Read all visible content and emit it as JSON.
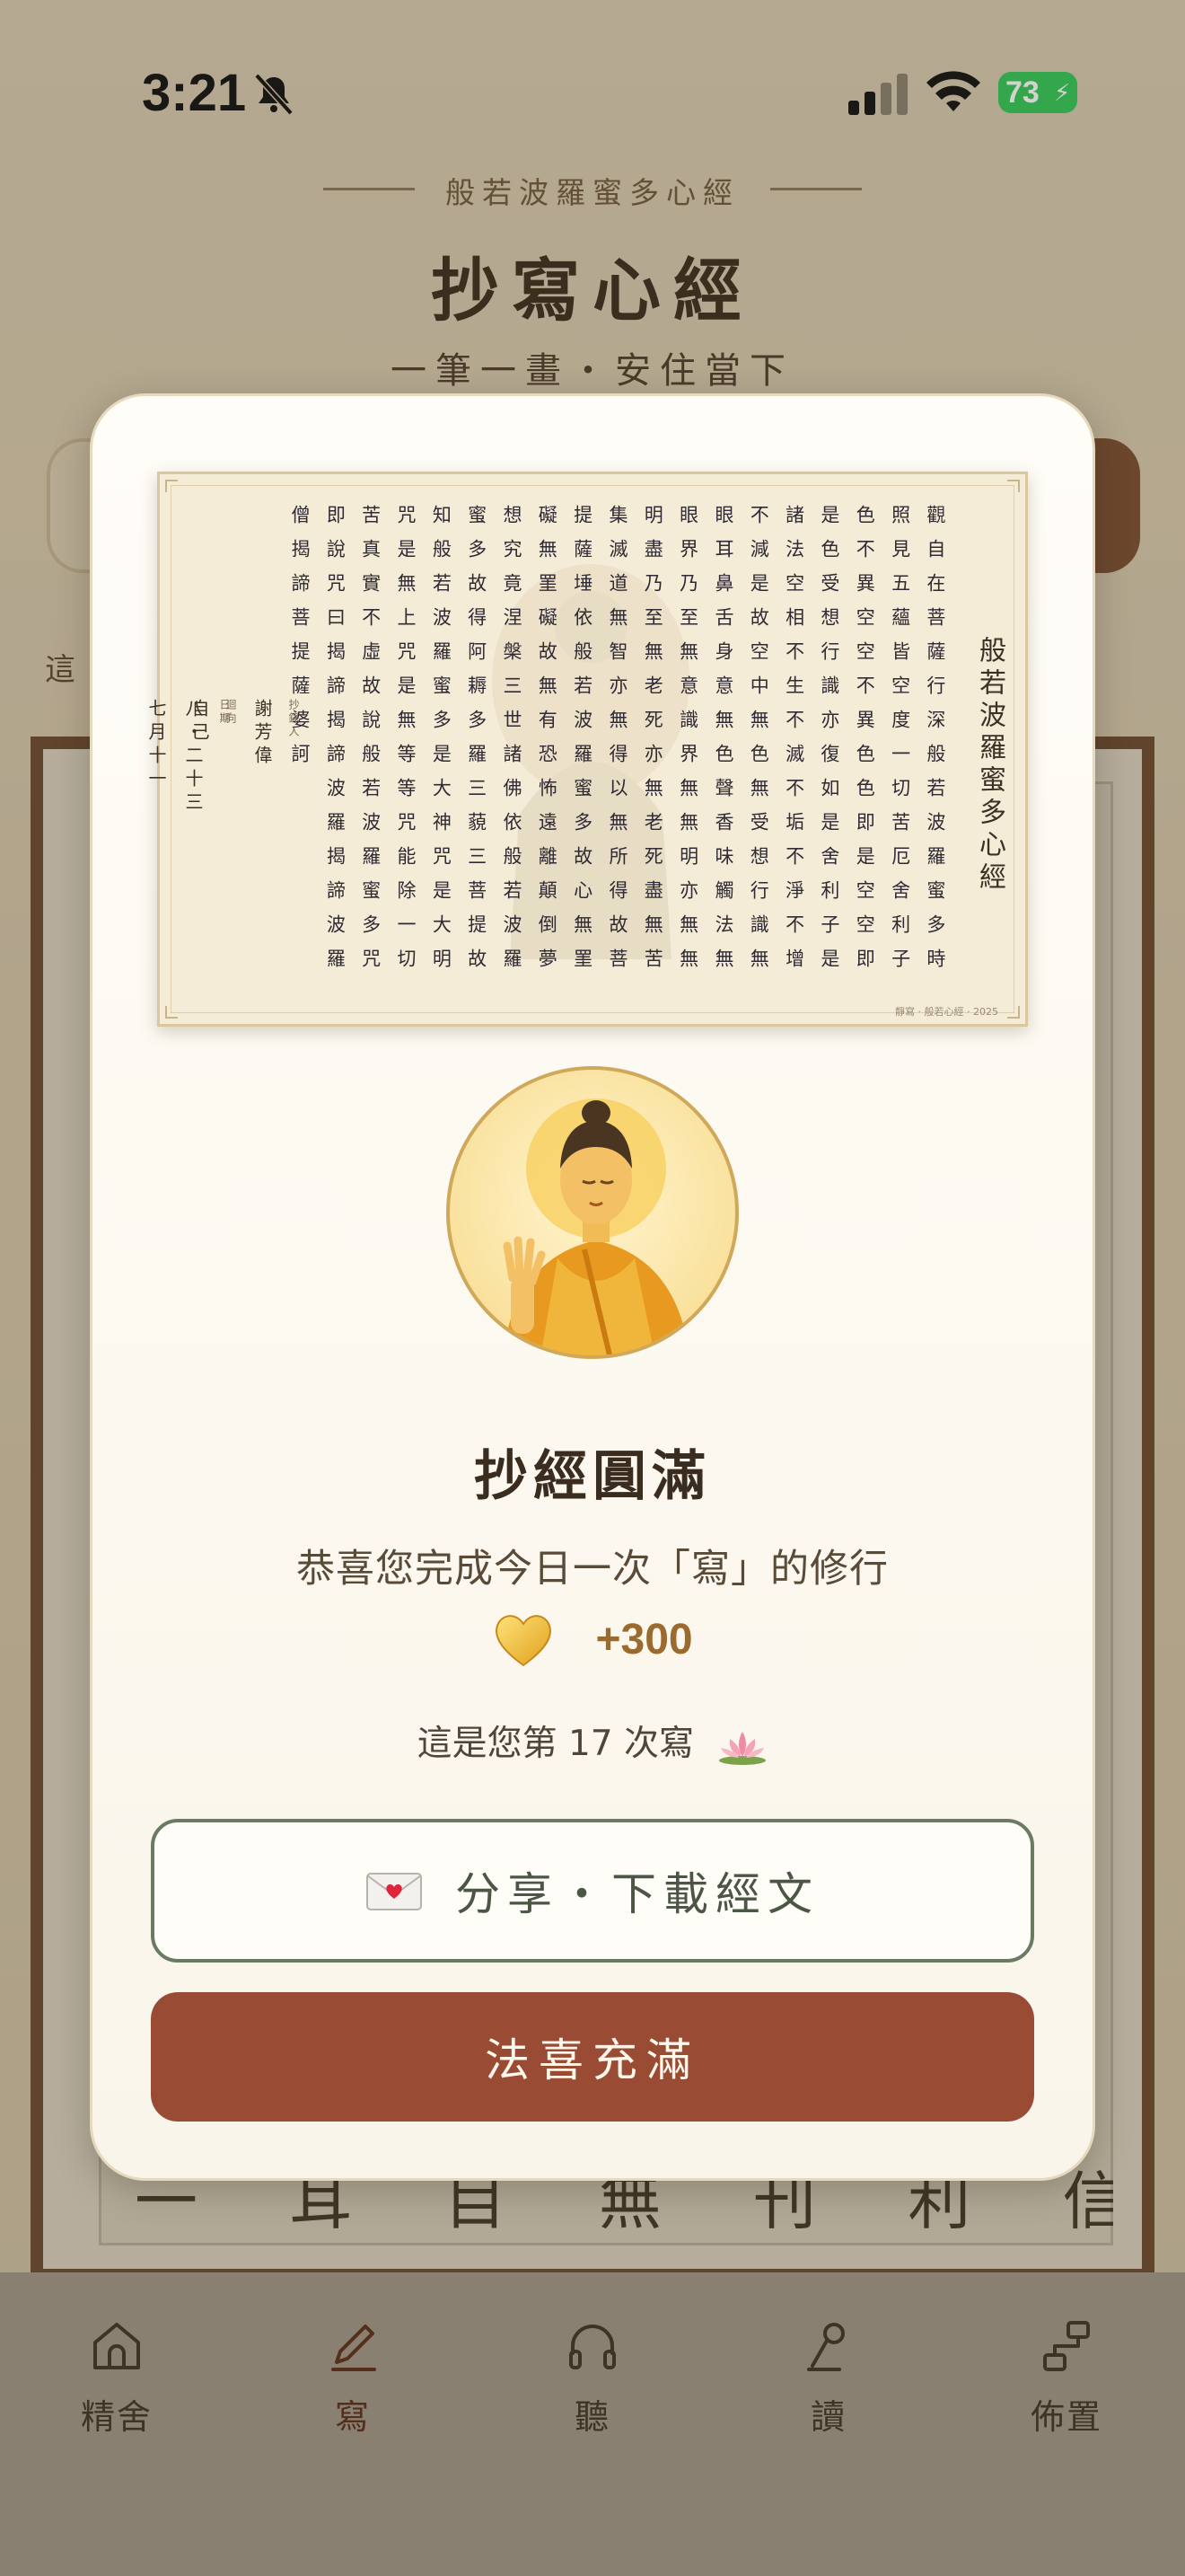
{
  "status_bar": {
    "time": "3:21",
    "battery": "73"
  },
  "header": {
    "sutra_name": "般若波羅蜜多心經",
    "title": "抄寫心經",
    "tagline": "一筆一畫・安住當下"
  },
  "background": {
    "side_text": "這",
    "brush_row": "一 耳 目 無 刊 利 信 是 印 手 時"
  },
  "preview": {
    "sutra_title": "般若波羅蜜多心經",
    "columns": [
      "觀自在菩薩行深般若波羅蜜多時",
      "照見五蘊皆空度一切苦厄舍利子",
      "色不異空空不異色色即是空空即",
      "是色受想行識亦復如是舍利子是",
      "諸法空相不生不滅不垢不淨不增",
      "不減是故空中無色無受想行識無",
      "眼耳鼻舌身意無色聲香味觸法無",
      "眼界乃至無意識界無無明亦無無",
      "明盡乃至無老死亦無老死盡無苦",
      "集滅道無智亦無得以無所得故菩",
      "提薩埵依般若波羅蜜多故心無罣",
      "礙無罣礙故無有恐怖遠離顛倒夢",
      "想究竟涅槃三世諸佛依般若波羅",
      "蜜多故得阿耨多羅三藐三菩提故",
      "知般若波羅蜜多是大神咒是大明",
      "咒是無上咒是無等等咒能除一切",
      "苦真實不虛故說般若波羅蜜多咒",
      "即說咒曰揭諦揭諦波羅揭諦波羅",
      "僧揭諦菩提薩婆訶"
    ],
    "copyist_label": "抄錄人",
    "copyist_name": "謝芳偉",
    "dedication_label": "迴向",
    "dedication": "自己",
    "date_label": "日期",
    "date_month": "七月十一",
    "date_day": "八・二十三",
    "footer": "靜寫 · 般若心經 · 2025"
  },
  "completion": {
    "title": "抄經圓滿",
    "message": "恭喜您完成今日一次「寫」的修行",
    "merit": "+300",
    "count_text": "這是您第 17 次寫"
  },
  "buttons": {
    "share": "分享・下載經文",
    "confirm": "法喜充滿"
  },
  "tabs": [
    {
      "label": "精舍",
      "icon": "home-icon"
    },
    {
      "label": "寫",
      "icon": "pen-icon"
    },
    {
      "label": "聽",
      "icon": "headphones-icon"
    },
    {
      "label": "讀",
      "icon": "reading-icon"
    },
    {
      "label": "佈置",
      "icon": "layout-icon"
    }
  ],
  "colors": {
    "accent": "#9a4b34",
    "share_border": "#6b7a62",
    "merit": "#9a6a2e",
    "battery": "#33c759"
  }
}
